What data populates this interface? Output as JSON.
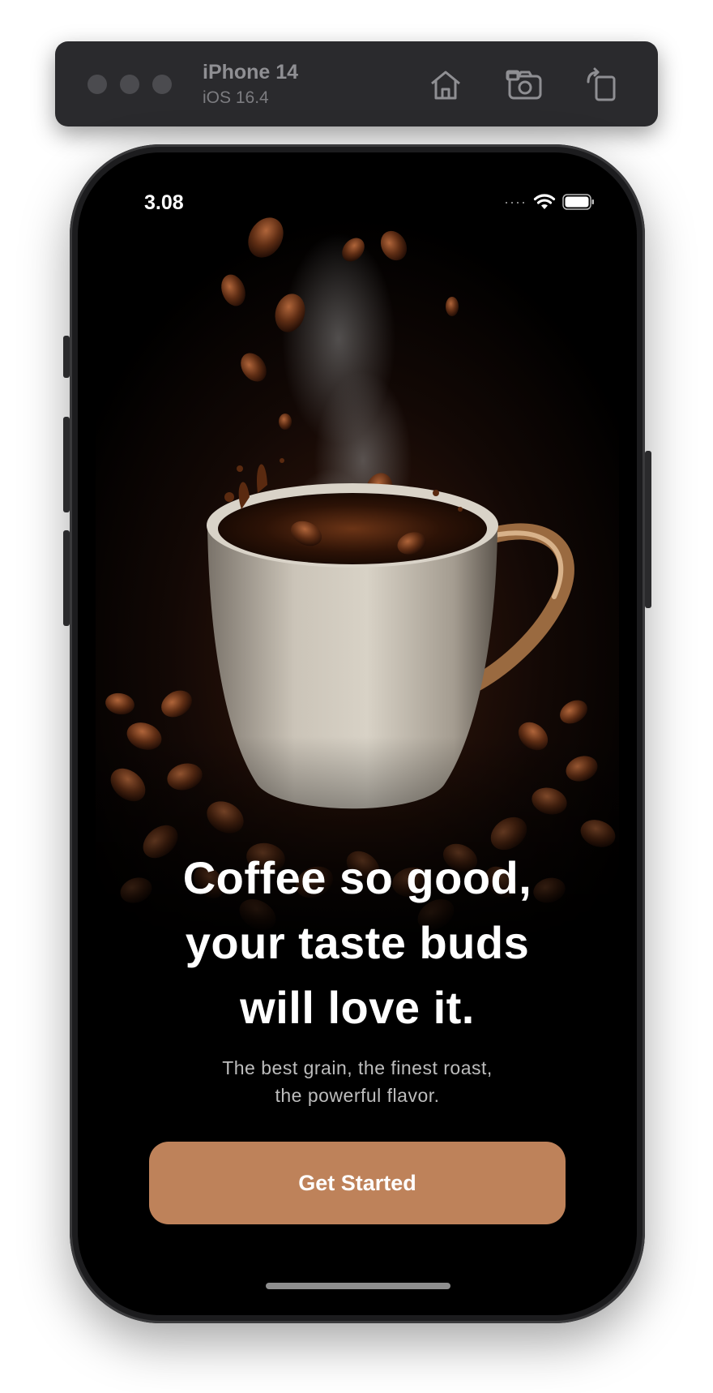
{
  "simulator": {
    "device_name": "iPhone 14",
    "os_version": "iOS 16.4",
    "toolbar_icons": [
      "home-icon",
      "screenshot-icon",
      "rotate-icon"
    ]
  },
  "status_bar": {
    "time": "3.08",
    "signal_dots": "····"
  },
  "hero": {
    "image": "coffee-cup-with-beans-photo"
  },
  "onboarding": {
    "headline_lines": [
      "Coffee so good,",
      "your taste buds",
      "will love it."
    ],
    "subtitle_lines": [
      "The best grain, the finest roast,",
      "the powerful flavor."
    ],
    "cta_label": "Get Started"
  },
  "colors": {
    "accent": "#be825a",
    "background": "#000000",
    "headline": "#ffffff",
    "subtitle": "#bdbdbd"
  }
}
